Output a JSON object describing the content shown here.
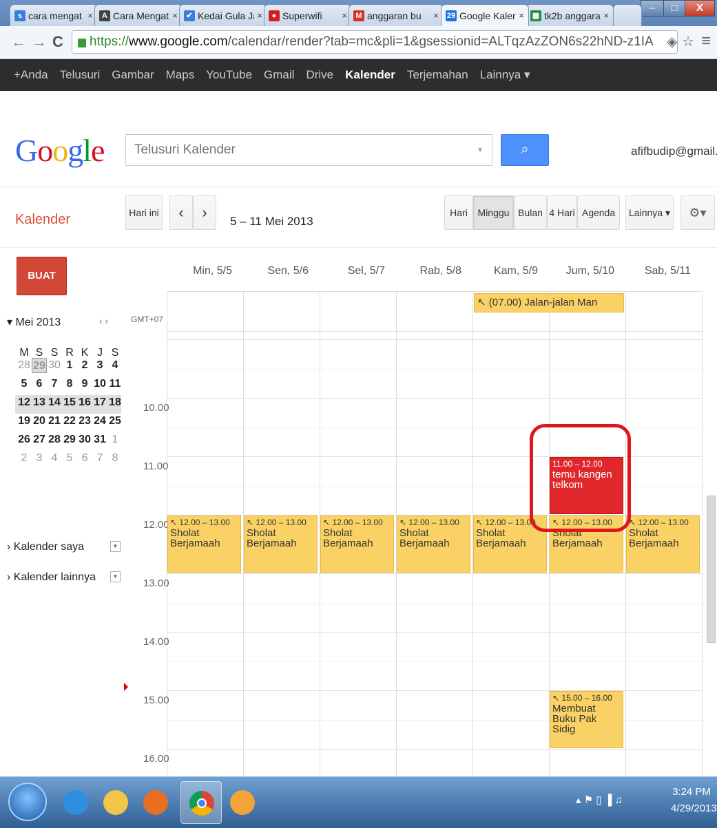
{
  "browser": {
    "tabs": [
      {
        "label": "cara mengat",
        "favicon": "s",
        "color": "#3b7ddd"
      },
      {
        "label": "Cara Mengat",
        "favicon": "A",
        "color": "#444444"
      },
      {
        "label": "Kedai Gula Ja",
        "favicon": "✔",
        "color": "#3b7ddd"
      },
      {
        "label": "Superwifi",
        "favicon": "●",
        "color": "#d41e1e"
      },
      {
        "label": "anggaran bu",
        "favicon": "M",
        "color": "#d93025"
      },
      {
        "label": "Google Kaler",
        "favicon": "29",
        "color": "#1a73e8"
      },
      {
        "label": "tk2b anggara",
        "favicon": "▦",
        "color": "#1e8e3e"
      }
    ],
    "active_tab_index": 5,
    "close_glyph": "×",
    "url": {
      "scheme": "https://",
      "domain": "www.google.com",
      "path": "/calendar/render?tab=mc&pli=1&gsessionid=ALTqzAzZON6s22hND-z1IA"
    },
    "window_buttons": {
      "minimize": "–",
      "maximize": "□",
      "close": "X"
    },
    "icons": {
      "back": "←",
      "forward": "→",
      "reload": "C",
      "menu": "≡",
      "star": "☆",
      "extension": "◈"
    }
  },
  "google_bar": [
    "+Anda",
    "Telusuri",
    "Gambar",
    "Maps",
    "YouTube",
    "Gmail",
    "Drive",
    "Kalender",
    "Terjemahan",
    "Lainnya ▾"
  ],
  "google_bar_active": "Kalender",
  "header": {
    "logo": [
      "G",
      "o",
      "o",
      "g",
      "l",
      "e"
    ],
    "search_placeholder": "Telusuri Kalender",
    "search_icon": "⌕",
    "account": "afifbudip@gmail.com"
  },
  "toolbar": {
    "app_title": "Kalender",
    "today": "Hari ini",
    "prev": "‹",
    "next": "›",
    "date_range": "5 – 11 Mei 2013",
    "views": [
      "Hari",
      "Minggu",
      "Bulan",
      "4 Hari",
      "Agenda"
    ],
    "active_view": "Minggu",
    "more": "Lainnya ▾",
    "settings": "⚙▾"
  },
  "sidebar": {
    "create": "BUAT",
    "month_title": "▾ Mei 2013",
    "month_nav": "‹  ›",
    "dows": [
      "M",
      "S",
      "S",
      "R",
      "K",
      "J",
      "S"
    ],
    "weeks": [
      [
        "28",
        "29",
        "30",
        "1",
        "2",
        "3",
        "4"
      ],
      [
        "5",
        "6",
        "7",
        "8",
        "9",
        "10",
        "11"
      ],
      [
        "12",
        "13",
        "14",
        "15",
        "16",
        "17",
        "18"
      ],
      [
        "19",
        "20",
        "21",
        "22",
        "23",
        "24",
        "25"
      ],
      [
        "26",
        "27",
        "28",
        "29",
        "30",
        "31",
        "1"
      ],
      [
        "2",
        "3",
        "4",
        "5",
        "6",
        "7",
        "8"
      ]
    ],
    "my_calendars": "› Kalender saya",
    "other_calendars": "› Kalender lainnya",
    "dropdown_glyph": "▼"
  },
  "calendar": {
    "timezone": "GMT+07",
    "days": [
      "Min, 5/5",
      "Sen, 5/6",
      "Sel, 5/7",
      "Rab, 5/8",
      "Kam, 5/9",
      "Jum, 5/10",
      "Sab, 5/11"
    ],
    "hours": [
      "10.00",
      "11.00",
      "12.00",
      "13.00",
      "14.00",
      "15.00",
      "16.00"
    ],
    "allday_event": {
      "day": 4,
      "span": 2,
      "text": "↖ (07.00) Jalan-jalan Man"
    },
    "events": [
      {
        "day": 0,
        "start": 12,
        "end": 13,
        "time": "↖ 12.00 – 13.00",
        "title": "Sholat Berjamaah",
        "style": "yellow"
      },
      {
        "day": 1,
        "start": 12,
        "end": 13,
        "time": "↖ 12.00 – 13.00",
        "title": "Sholat Berjamaah",
        "style": "yellow"
      },
      {
        "day": 2,
        "start": 12,
        "end": 13,
        "time": "↖ 12.00 – 13.00",
        "title": "Sholat Berjamaah",
        "style": "yellow"
      },
      {
        "day": 3,
        "start": 12,
        "end": 13,
        "time": "↖ 12.00 – 13.00",
        "title": "Sholat Berjamaah",
        "style": "yellow"
      },
      {
        "day": 4,
        "start": 12,
        "end": 13,
        "time": "↖ 12.00 – 13.00",
        "title": "Sholat Berjamaah",
        "style": "yellow"
      },
      {
        "day": 5,
        "start": 12,
        "end": 13,
        "time": "↖ 12.00 – 13.00",
        "title": "Sholat Berjamaah",
        "style": "yellow"
      },
      {
        "day": 6,
        "start": 12,
        "end": 13,
        "time": "↖ 12.00 – 13.00",
        "title": "Sholat Berjamaah",
        "style": "yellow"
      },
      {
        "day": 5,
        "start": 11,
        "end": 12,
        "time": "11.00 – 12.00",
        "title": "temu kangen telkom",
        "style": "red"
      },
      {
        "day": 5,
        "start": 15,
        "end": 16,
        "time": "↖ 15.00 – 16.00",
        "title": "Membuat Buku Pak Sidig",
        "style": "yellow"
      }
    ],
    "highlighted_event_index": 7
  },
  "taskbar": {
    "apps": [
      "start-orb",
      "internet-explorer-icon",
      "file-explorer-icon",
      "media-player-icon",
      "chrome-icon",
      "paint-icon"
    ],
    "active_app": "chrome-icon",
    "tray": "▴  ⚑  ▯  ▐  ♫",
    "time": "3:24 PM",
    "date": "4/29/2013"
  },
  "colors": {
    "event_yellow": "#fad165",
    "event_red": "#e0272c",
    "create_button": "#d14836",
    "search_button": "#4d90fe",
    "app_title": "#dd4b39"
  }
}
